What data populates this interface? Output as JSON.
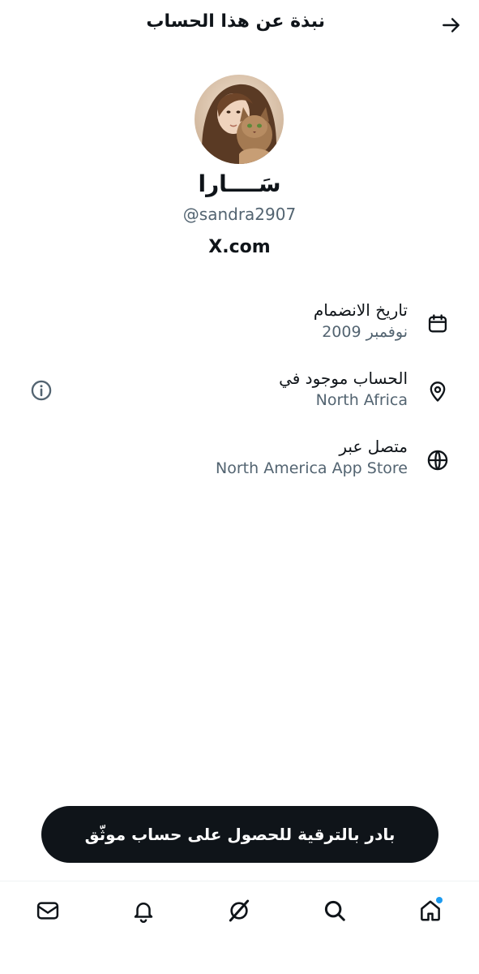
{
  "header": {
    "title": "نبذة عن هذا الحساب"
  },
  "profile": {
    "display_name": "سَــــارا",
    "handle": "@sandra2907",
    "site": "X.com"
  },
  "info": [
    {
      "label": "تاريخ الانضمام",
      "value": "نوفمبر 2009",
      "icon": "calendar-icon"
    },
    {
      "label": "الحساب موجود في",
      "value": "North Africa",
      "icon": "location-pin-icon"
    },
    {
      "label": "متصل عبر",
      "value": "North America App Store",
      "icon": "globe-icon"
    }
  ],
  "upgrade": {
    "label": "بادر بالترقية للحصول على حساب موثّق"
  },
  "nav": {
    "items": [
      "messages-icon",
      "notifications-icon",
      "grok-icon",
      "search-icon",
      "home-icon"
    ]
  },
  "colors": {
    "text": "#0f1419",
    "secondary": "#536471",
    "accent": "#1d9bf0"
  }
}
